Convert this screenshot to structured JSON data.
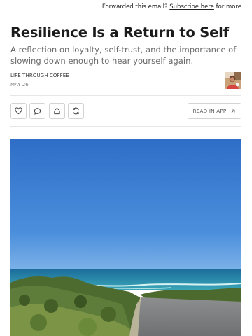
{
  "header": {
    "forward_prefix": "Forwarded this email? ",
    "subscribe_link": "Subscribe here",
    "forward_suffix": " for more"
  },
  "post": {
    "title": "Resilience Is a Return to Self",
    "subtitle": "A reflection on loyalty, self-trust, and the importance of slowing down enough to hear yourself again.",
    "publication": "LIFE THROUGH COFFEE",
    "date": "MAY 26"
  },
  "actions": {
    "icons": [
      "heart-icon",
      "comment-icon",
      "share-icon",
      "restack-icon"
    ],
    "read_in_app_label": "READ IN APP"
  },
  "colors": {
    "sky": "#3f7fd1",
    "ocean": "#2a8fa8",
    "text": "#1b1b1b",
    "muted": "#6b6b6b"
  }
}
